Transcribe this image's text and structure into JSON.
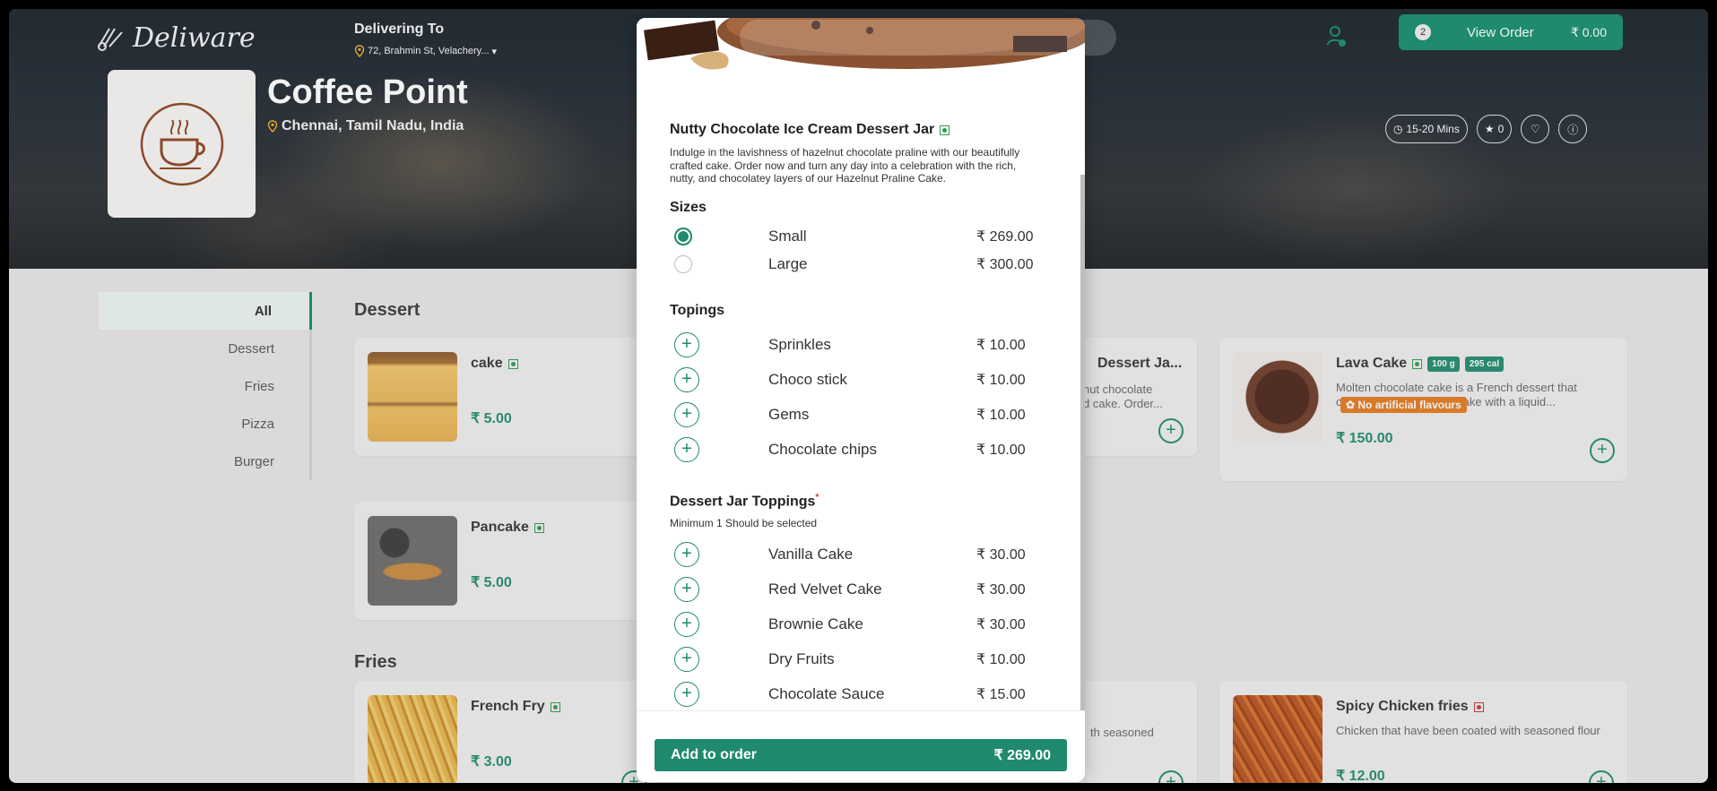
{
  "header": {
    "brand": "Deliware",
    "delivering_to_label": "Delivering To",
    "address": "72, Brahmin St, Velachery...",
    "view_order": {
      "count": "2",
      "label": "View Order",
      "amount": "₹ 0.00"
    }
  },
  "store": {
    "name": "Coffee Point",
    "location": "Chennai, Tamil Nadu, India",
    "delivery_time": "15-20 Mins",
    "rating": "0"
  },
  "categories": [
    "All",
    "Dessert",
    "Fries",
    "Pizza",
    "Burger"
  ],
  "sections": {
    "dessert": "Dessert",
    "fries": "Fries"
  },
  "products": {
    "cake": {
      "name": "cake",
      "price": "₹ 5.00"
    },
    "dessert_jar": {
      "name": "Dessert Ja...",
      "desc": "nut chocolate\nd cake. Order..."
    },
    "lava": {
      "name": "Lava Cake",
      "weight": "100 g",
      "cal": "295 cal",
      "desc": "Molten chocolate cake is a French dessert that consists of a chocolate cake with a liquid...",
      "tag": "No artificial flavours",
      "price": "₹ 150.00"
    },
    "pancake": {
      "name": "Pancake",
      "price": "₹ 5.00"
    },
    "french_fry": {
      "name": "French Fry",
      "price": "₹ 3.00"
    },
    "mid_fries": {
      "desc": "th seasoned"
    },
    "spicy": {
      "name": "Spicy Chicken fries",
      "desc": "Chicken that have been coated with seasoned flour",
      "price": "₹ 12.00"
    }
  },
  "modal": {
    "product_name": "Nutty Chocolate Ice Cream Dessert Jar",
    "description": "Indulge in the lavishness of hazelnut chocolate praline with our beautifully crafted cake. Order now and turn any day into a celebration with the rich, nutty, and chocolatey layers of our Hazelnut Praline Cake.",
    "sizes_title": "Sizes",
    "sizes": [
      {
        "name": "Small",
        "price": "₹ 269.00",
        "selected": true
      },
      {
        "name": "Large",
        "price": "₹ 300.00",
        "selected": false
      }
    ],
    "toppings_title": "Topings",
    "toppings": [
      {
        "name": "Sprinkles",
        "price": "₹ 10.00"
      },
      {
        "name": "Choco stick",
        "price": "₹ 10.00"
      },
      {
        "name": "Gems",
        "price": "₹ 10.00"
      },
      {
        "name": "Chocolate chips",
        "price": "₹ 10.00"
      }
    ],
    "jar_toppings_title": "Dessert Jar Toppings",
    "jar_toppings_required": "*",
    "jar_toppings_note": "Minimum 1 Should be selected",
    "jar_toppings": [
      {
        "name": "Vanilla Cake",
        "price": "₹ 30.00"
      },
      {
        "name": "Red Velvet Cake",
        "price": "₹ 30.00"
      },
      {
        "name": "Brownie Cake",
        "price": "₹ 30.00"
      },
      {
        "name": "Dry Fruits",
        "price": "₹ 10.00"
      },
      {
        "name": "Chocolate Sauce",
        "price": "₹ 15.00"
      }
    ],
    "add_label": "Add to order",
    "add_amount": "₹ 269.00"
  },
  "colors": {
    "accent": "#1f8a6d",
    "veg": "#2e9a4e",
    "nonveg": "#c73737",
    "tag_orange": "#e57a1f"
  }
}
